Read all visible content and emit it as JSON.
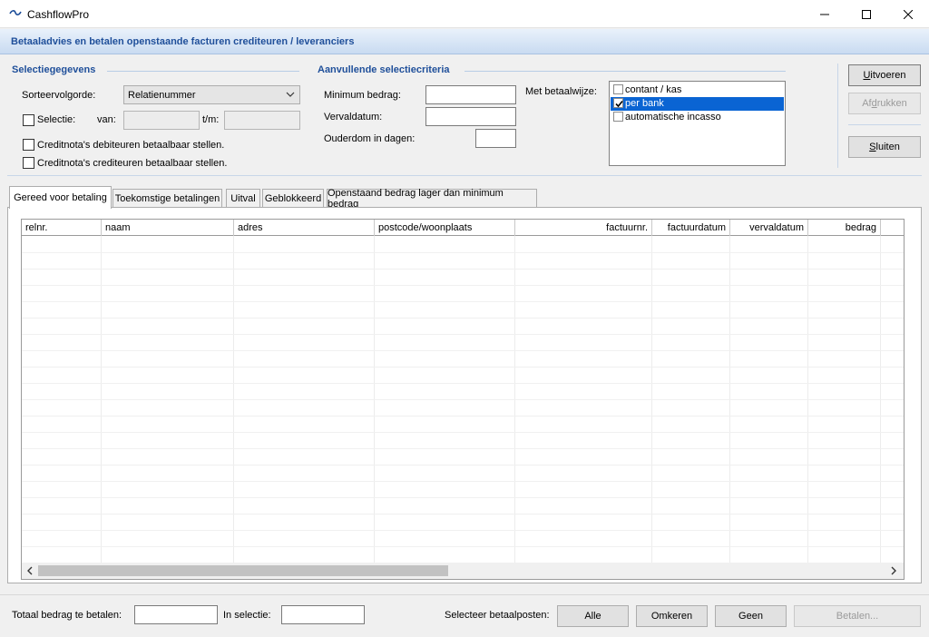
{
  "window": {
    "title": "CashflowPro"
  },
  "banner": {
    "title": "Betaaladvies en betalen openstaande facturen crediteuren / leveranciers"
  },
  "selection": {
    "title": "Selectiegegevens",
    "sort_label": "Sorteervolgorde:",
    "sort_value": "Relatienummer",
    "selection_label": "Selectie:",
    "from_label": "van:",
    "to_label": "t/m:",
    "from_value": "",
    "to_value": "",
    "credit_debtors_label": "Creditnota's debiteuren betaalbaar stellen.",
    "credit_creditors_label": "Creditnota's crediteuren betaalbaar stellen."
  },
  "criteria": {
    "title": "Aanvullende selectiecriteria",
    "min_amount_label": "Minimum bedrag:",
    "due_date_label": "Vervaldatum:",
    "age_label": "Ouderdom in dagen:",
    "payment_method_label": "Met betaalwijze:",
    "payment_methods": [
      {
        "label": "contant / kas",
        "checked": false,
        "selected": false
      },
      {
        "label": "per bank",
        "checked": true,
        "selected": true
      },
      {
        "label": "automatische incasso",
        "checked": false,
        "selected": false
      }
    ]
  },
  "actions": {
    "execute_rest": "itvoeren",
    "execute_u": "U",
    "print_pre": "Af",
    "print_u": "d",
    "print_rest": "rukken",
    "close_u": "S",
    "close_rest": "luiten"
  },
  "tabs": [
    "Gereed voor betaling",
    "Toekomstige betalingen",
    "Uitval",
    "Geblokkeerd",
    "Openstaand bedrag lager dan minimum bedrag"
  ],
  "grid": {
    "columns": [
      "relnr.",
      "naam",
      "adres",
      "postcode/woonplaats",
      "factuurnr.",
      "factuurdatum",
      "vervaldatum",
      "bedrag"
    ]
  },
  "footer": {
    "total_label": "Totaal bedrag te betalen:",
    "in_selection_label": "In selectie:",
    "select_label": "Selecteer betaalposten:",
    "all_button": "Alle",
    "invert_button": "Omkeren",
    "none_button": "Geen",
    "pay_button": "Betalen..."
  }
}
